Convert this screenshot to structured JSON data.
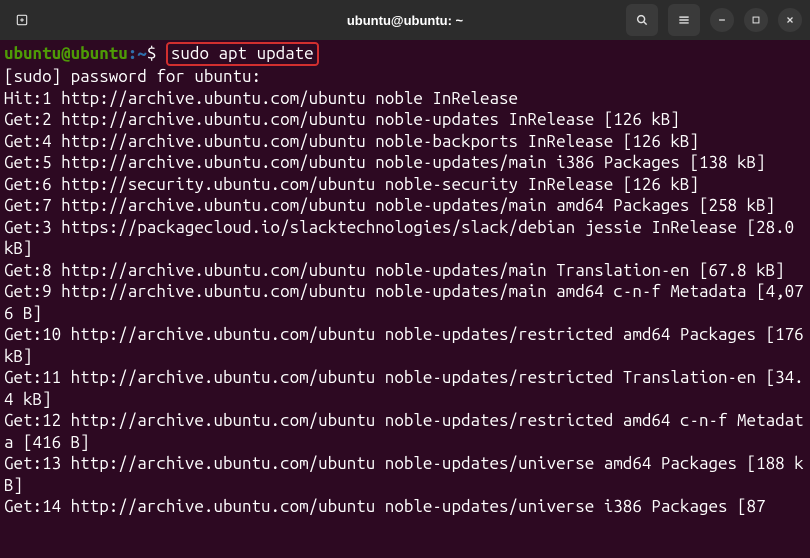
{
  "window": {
    "title": "ubuntu@ubuntu: ~"
  },
  "prompt": {
    "userhost": "ubuntu@ubuntu",
    "path": "~",
    "separator": ":",
    "symbol": "$"
  },
  "command": "sudo apt update",
  "output_lines": [
    "[sudo] password for ubuntu:",
    "Hit:1 http://archive.ubuntu.com/ubuntu noble InRelease",
    "Get:2 http://archive.ubuntu.com/ubuntu noble-updates InRelease [126 kB]",
    "Get:4 http://archive.ubuntu.com/ubuntu noble-backports InRelease [126 kB]",
    "Get:5 http://archive.ubuntu.com/ubuntu noble-updates/main i386 Packages [138 kB]",
    "Get:6 http://security.ubuntu.com/ubuntu noble-security InRelease [126 kB]",
    "Get:7 http://archive.ubuntu.com/ubuntu noble-updates/main amd64 Packages [258 kB]",
    "Get:3 https://packagecloud.io/slacktechnologies/slack/debian jessie InRelease [28.0 kB]",
    "Get:8 http://archive.ubuntu.com/ubuntu noble-updates/main Translation-en [67.8 kB]",
    "Get:9 http://archive.ubuntu.com/ubuntu noble-updates/main amd64 c-n-f Metadata [4,076 B]",
    "Get:10 http://archive.ubuntu.com/ubuntu noble-updates/restricted amd64 Packages [176 kB]",
    "Get:11 http://archive.ubuntu.com/ubuntu noble-updates/restricted Translation-en [34.4 kB]",
    "Get:12 http://archive.ubuntu.com/ubuntu noble-updates/restricted amd64 c-n-f Metadata [416 B]",
    "Get:13 http://archive.ubuntu.com/ubuntu noble-updates/universe amd64 Packages [188 kB]",
    "Get:14 http://archive.ubuntu.com/ubuntu noble-updates/universe i386 Packages [87"
  ]
}
